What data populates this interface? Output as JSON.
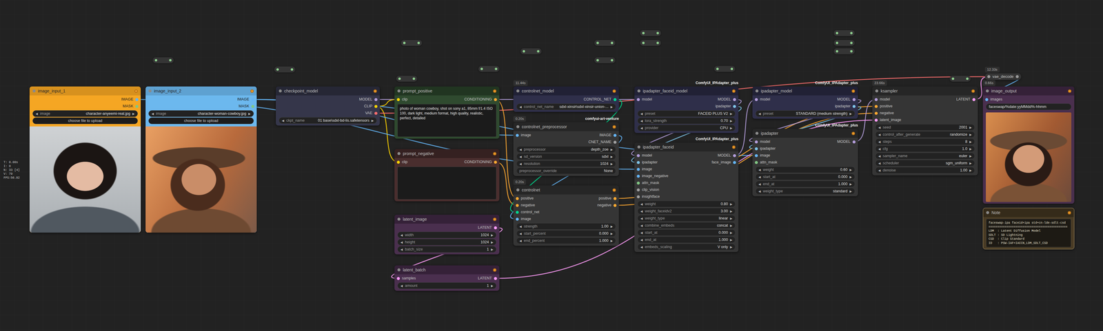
{
  "stats": [
    "T: 0.00s",
    "I: 0",
    "N: 33 [4]",
    "V: 79",
    "FPS:56.92"
  ],
  "arrows": [
    "◀",
    "▶"
  ],
  "nodes": [
    {
      "title": "image_input_1",
      "color": "#f5a623",
      "badge": null,
      "source": null,
      "collapsed": false,
      "preview": true,
      "inputs": [],
      "outputs": [
        {
          "label": "IMAGE",
          "color": "#64b5f6"
        },
        {
          "label": "MASK",
          "color": "#81c784"
        }
      ],
      "widgets": [
        {
          "kind": "combo",
          "label": "image",
          "value": "character-anyeemi-real.jpg"
        },
        {
          "kind": "button",
          "label": "choose file to upload"
        }
      ]
    },
    {
      "title": "image_input_2",
      "color": "#6cb8ee",
      "badge": null,
      "source": null,
      "collapsed": false,
      "preview": true,
      "inputs": [],
      "outputs": [
        {
          "label": "IMAGE",
          "color": "#64b5f6"
        },
        {
          "label": "MASK",
          "color": "#81c784"
        }
      ],
      "widgets": [
        {
          "kind": "combo",
          "label": "image",
          "value": "character-woman-cowboy.jpg"
        },
        {
          "kind": "button",
          "label": "choose file to upload"
        }
      ]
    },
    {
      "title": "checkpoint_model",
      "color": "#35364a",
      "badge": null,
      "source": null,
      "collapsed": false,
      "preview": false,
      "inputs": [],
      "outputs": [
        {
          "label": "MODEL",
          "color": "#b39ddb"
        },
        {
          "label": "CLIP",
          "color": "#ffd500"
        },
        {
          "label": "VAE",
          "color": "#ff6e6e"
        }
      ],
      "widgets": [
        {
          "kind": "combo",
          "label": "ckpt_name",
          "value": "01 base\\sdxl-bd-lis.safetensors"
        }
      ]
    },
    {
      "title": "prompt_positive",
      "color": "#2f4a2f",
      "badge": null,
      "source": null,
      "collapsed": false,
      "preview": false,
      "inputs": [
        {
          "label": "clip",
          "color": "#ffd500"
        }
      ],
      "outputs": [
        {
          "label": "CONDITIONING",
          "color": "#ffa931"
        }
      ],
      "widgets": [
        {
          "kind": "textarea",
          "label": "text",
          "value": "photo of woman cowboy, shot on sony a1, 85mm f/1.4 ISO 100, dark light, medium format, high quality, realistic, perfect, detailed"
        }
      ]
    },
    {
      "title": "prompt_negative",
      "color": "#4a2e2e",
      "badge": null,
      "source": null,
      "collapsed": false,
      "preview": false,
      "inputs": [
        {
          "label": "clip",
          "color": "#ffd500"
        }
      ],
      "outputs": [
        {
          "label": "CONDITIONING",
          "color": "#ffa931"
        }
      ],
      "widgets": [
        {
          "kind": "textarea",
          "label": "text",
          "value": ""
        }
      ]
    },
    {
      "title": "latent_image",
      "color": "#4a2f4e",
      "badge": null,
      "source": null,
      "collapsed": false,
      "preview": false,
      "inputs": [],
      "outputs": [
        {
          "label": "LATENT",
          "color": "#ff9cf9"
        }
      ],
      "widgets": [
        {
          "kind": "number",
          "label": "width",
          "value": "1024"
        },
        {
          "kind": "number",
          "label": "height",
          "value": "1024"
        },
        {
          "kind": "number",
          "label": "batch_size",
          "value": "1"
        }
      ]
    },
    {
      "title": "latent_batch",
      "color": "#4a2f4e",
      "badge": null,
      "source": null,
      "collapsed": false,
      "preview": false,
      "inputs": [
        {
          "label": "samples",
          "color": "#ff9cf9"
        }
      ],
      "outputs": [
        {
          "label": "LATENT",
          "color": "#ff9cf9"
        }
      ],
      "widgets": [
        {
          "kind": "number",
          "label": "amount",
          "value": "1"
        }
      ]
    },
    {
      "title": "controlnet_model",
      "color": "#2f2f4a",
      "badge": "11.44s",
      "source": null,
      "collapsed": false,
      "preview": false,
      "inputs": [],
      "outputs": [
        {
          "label": "CONTROL_NET",
          "color": "#00d78d"
        }
      ],
      "widgets": [
        {
          "kind": "combo",
          "label": "control_net_name",
          "value": "sdxl-xinsir\\sdxl-xinsir-union-..."
        }
      ]
    },
    {
      "title": "controlnet_preprocessor",
      "color": "#353535",
      "badge": "0.20s",
      "source": "comfyui-art-venture",
      "collapsed": false,
      "preview": false,
      "inputs": [
        {
          "label": "image",
          "color": "#64b5f6"
        }
      ],
      "outputs": [
        {
          "label": "IMAGE",
          "color": "#64b5f6"
        },
        {
          "label": "CNET_NAME",
          "color": "#a0a0a0"
        }
      ],
      "widgets": [
        {
          "kind": "combo",
          "label": "preprocessor",
          "value": "depth_zoe"
        },
        {
          "kind": "combo",
          "label": "sd_version",
          "value": "sdxl"
        },
        {
          "kind": "number",
          "label": "resolution",
          "value": "1024"
        },
        {
          "kind": "text",
          "label": "preprocessor_override",
          "value": "None"
        }
      ]
    },
    {
      "title": "controlnet",
      "color": "#353535",
      "badge": "0.20s",
      "source": null,
      "collapsed": false,
      "preview": false,
      "inputs": [
        {
          "label": "positive",
          "color": "#ffa931"
        },
        {
          "label": "negative",
          "color": "#ffa931"
        },
        {
          "label": "control_net",
          "color": "#00d78d"
        },
        {
          "label": "image",
          "color": "#64b5f6"
        }
      ],
      "outputs": [
        {
          "label": "positive",
          "color": "#ffa931"
        },
        {
          "label": "negative",
          "color": "#ffa931"
        }
      ],
      "widgets": [
        {
          "kind": "number",
          "label": "strength",
          "value": "1.00"
        },
        {
          "kind": "number",
          "label": "start_percent",
          "value": "0.000"
        },
        {
          "kind": "number",
          "label": "end_percent",
          "value": "1.000"
        }
      ]
    },
    {
      "title": "ipadapter_faceid_model",
      "color": "#2f2f4a",
      "badge": null,
      "source": "ComfyUI_IPAdapter_plus",
      "collapsed": false,
      "preview": false,
      "inputs": [
        {
          "label": "model",
          "color": "#b39ddb"
        }
      ],
      "outputs": [
        {
          "label": "MODEL",
          "color": "#b39ddb"
        },
        {
          "label": "ipadapter",
          "color": "#7fc4e8"
        }
      ],
      "widgets": [
        {
          "kind": "combo",
          "label": "preset",
          "value": "FACEID PLUS V2"
        },
        {
          "kind": "number",
          "label": "lora_strength",
          "value": "0.70"
        },
        {
          "kind": "combo",
          "label": "provider",
          "value": "CPU"
        }
      ]
    },
    {
      "title": "ipadapter_faceid",
      "color": "#353535",
      "badge": null,
      "source": "ComfyUI_IPAdapter_plus",
      "collapsed": false,
      "preview": false,
      "inputs": [
        {
          "label": "model",
          "color": "#b39ddb"
        },
        {
          "label": "ipadapter",
          "color": "#7fc4e8"
        },
        {
          "label": "image",
          "color": "#64b5f6"
        },
        {
          "label": "image_negative",
          "color": "#64b5f6"
        },
        {
          "label": "attn_mask",
          "color": "#81c784"
        },
        {
          "label": "clip_vision",
          "color": "#a0a0a0"
        },
        {
          "label": "insightface",
          "color": "#a0a0a0"
        }
      ],
      "outputs": [
        {
          "label": "MODEL",
          "color": "#b39ddb"
        },
        {
          "label": "face_image",
          "color": "#64b5f6"
        }
      ],
      "widgets": [
        {
          "kind": "number",
          "label": "weight",
          "value": "0.80"
        },
        {
          "kind": "number",
          "label": "weight_faceidv2",
          "value": "3.00"
        },
        {
          "kind": "combo",
          "label": "weight_type",
          "value": "linear"
        },
        {
          "kind": "combo",
          "label": "combine_embeds",
          "value": "concat"
        },
        {
          "kind": "number",
          "label": "start_at",
          "value": "0.000"
        },
        {
          "kind": "number",
          "label": "end_at",
          "value": "1.000"
        },
        {
          "kind": "combo",
          "label": "embeds_scaling",
          "value": "V only"
        }
      ]
    },
    {
      "title": "ipadapter_model",
      "color": "#2f2f4a",
      "badge": null,
      "source": "ComfyUI_IPAdapter_plus",
      "collapsed": false,
      "preview": false,
      "inputs": [
        {
          "label": "model",
          "color": "#b39ddb"
        }
      ],
      "outputs": [
        {
          "label": "MODEL",
          "color": "#b39ddb"
        },
        {
          "label": "ipadapter",
          "color": "#7fc4e8"
        }
      ],
      "widgets": [
        {
          "kind": "combo",
          "label": "preset",
          "value": "STANDARD (medium strength)"
        }
      ]
    },
    {
      "title": "ipadapter",
      "color": "#353535",
      "badge": null,
      "source": "ComfyUI_IPAdapter_plus",
      "collapsed": false,
      "preview": false,
      "inputs": [
        {
          "label": "model",
          "color": "#b39ddb"
        },
        {
          "label": "ipadapter",
          "color": "#7fc4e8"
        },
        {
          "label": "image",
          "color": "#64b5f6"
        },
        {
          "label": "attn_mask",
          "color": "#81c784"
        }
      ],
      "outputs": [
        {
          "label": "MODEL",
          "color": "#b39ddb"
        }
      ],
      "widgets": [
        {
          "kind": "number",
          "label": "weight",
          "value": "0.60"
        },
        {
          "kind": "number",
          "label": "start_at",
          "value": "0.000"
        },
        {
          "kind": "number",
          "label": "end_at",
          "value": "1.000"
        },
        {
          "kind": "combo",
          "label": "weight_type",
          "value": "standard"
        }
      ]
    },
    {
      "title": "ksampler",
      "color": "#353535",
      "badge": "23.66s",
      "source": null,
      "collapsed": false,
      "preview": false,
      "inputs": [
        {
          "label": "model",
          "color": "#b39ddb"
        },
        {
          "label": "positive",
          "color": "#ffa931"
        },
        {
          "label": "negative",
          "color": "#ffa931"
        },
        {
          "label": "latent_image",
          "color": "#ff9cf9"
        }
      ],
      "outputs": [
        {
          "label": "LATENT",
          "color": "#ff9cf9"
        }
      ],
      "widgets": [
        {
          "kind": "number",
          "label": "seed",
          "value": "2001"
        },
        {
          "kind": "combo",
          "label": "control_after_generate",
          "value": "randomize"
        },
        {
          "kind": "number",
          "label": "steps",
          "value": "8"
        },
        {
          "kind": "number",
          "label": "cfg",
          "value": "1.0"
        },
        {
          "kind": "combo",
          "label": "sampler_name",
          "value": "euler"
        },
        {
          "kind": "combo",
          "label": "scheduler",
          "value": "sgm_uniform"
        },
        {
          "kind": "number",
          "label": "denoise",
          "value": "1.00"
        }
      ]
    },
    {
      "title": "vae_decode",
      "color": "#353535",
      "badge": "12.33s",
      "source": null,
      "collapsed": true,
      "preview": false,
      "inputs": [],
      "outputs": [],
      "widgets": []
    },
    {
      "title": "image_output",
      "color": "#4a2f4e",
      "badge": "0.66s",
      "source": null,
      "collapsed": false,
      "preview": true,
      "inputs": [
        {
          "label": "images",
          "color": "#64b5f6"
        }
      ],
      "outputs": [],
      "widgets": [
        {
          "kind": "string",
          "label": "filename_prefix",
          "value": "faceswap/%date:yyMMdd%-hhmm"
        }
      ]
    },
    {
      "title": "Note",
      "color": "#4a3c25",
      "badge": null,
      "source": null,
      "collapsed": false,
      "preview": false,
      "inputs": [],
      "outputs": [],
      "widgets": [
        {
          "kind": "note",
          "label": "text",
          "value": "faceswap-ipa faceid+ipa std+cn-lde-sdlt-csd\n============================================\nLDM  : Latent Diffusion Model\nSDLT : SD Lightning\nCSD  : Clip Standard\nID   : PSW-IAF+IACCN_LDM_SDLT_CSD"
        }
      ]
    }
  ],
  "links": [
    {
      "from": "checkpoint_model",
      "out": 0,
      "to": "ipadapter_faceid_model",
      "in": 0
    },
    {
      "from": "checkpoint_model",
      "out": 1,
      "to": "prompt_positive",
      "in": 0
    },
    {
      "from": "checkpoint_model",
      "out": 1,
      "to": "prompt_negative",
      "in": 0
    },
    {
      "from": "checkpoint_model",
      "out": 2,
      "to": "vae_decode",
      "in": 0
    },
    {
      "from": "image_input_1",
      "out": 0,
      "to": "ipadapter_faceid",
      "in": 2
    },
    {
      "from": "image_input_2",
      "out": 0,
      "to": "controlnet_preprocessor",
      "in": 0
    },
    {
      "from": "image_input_2",
      "out": 0,
      "to": "ipadapter",
      "in": 2
    },
    {
      "from": "prompt_positive",
      "out": 0,
      "to": "controlnet",
      "in": 0
    },
    {
      "from": "prompt_negative",
      "out": 0,
      "to": "controlnet",
      "in": 1
    },
    {
      "from": "controlnet_model",
      "out": 0,
      "to": "controlnet",
      "in": 2
    },
    {
      "from": "controlnet_preprocessor",
      "out": 0,
      "to": "controlnet",
      "in": 3
    },
    {
      "from": "controlnet",
      "out": 0,
      "to": "ksampler",
      "in": 1
    },
    {
      "from": "controlnet",
      "out": 1,
      "to": "ksampler",
      "in": 2
    },
    {
      "from": "ipadapter_faceid_model",
      "out": 0,
      "to": "ipadapter_faceid",
      "in": 0
    },
    {
      "from": "ipadapter_faceid_model",
      "out": 1,
      "to": "ipadapter_faceid",
      "in": 1
    },
    {
      "from": "ipadapter_faceid",
      "out": 0,
      "to": "ipadapter_model",
      "in": 0
    },
    {
      "from": "ipadapter_model",
      "out": 0,
      "to": "ipadapter",
      "in": 0
    },
    {
      "from": "ipadapter_model",
      "out": 1,
      "to": "ipadapter",
      "in": 1
    },
    {
      "from": "ipadapter",
      "out": 0,
      "to": "ksampler",
      "in": 0
    },
    {
      "from": "latent_image",
      "out": 0,
      "to": "latent_batch",
      "in": 0
    },
    {
      "from": "latent_batch",
      "out": 0,
      "to": "ksampler",
      "in": 3
    },
    {
      "from": "ksampler",
      "out": 0,
      "to": "vae_decode",
      "in": 0
    },
    {
      "from": "vae_decode",
      "out": 0,
      "to": "image_output",
      "in": 0
    }
  ]
}
